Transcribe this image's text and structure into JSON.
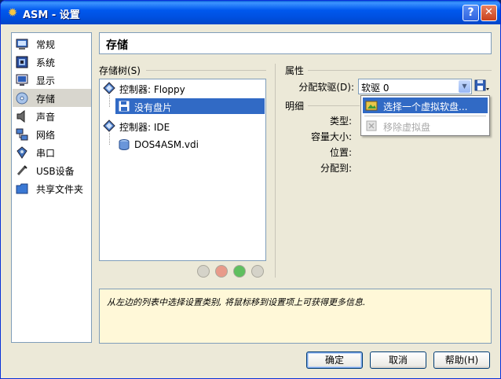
{
  "window": {
    "title": "ASM - 设置",
    "help_button": "?",
    "close_button": "✕"
  },
  "sidebar": {
    "items": [
      {
        "label": "常规",
        "icon": "general-icon"
      },
      {
        "label": "系统",
        "icon": "system-icon"
      },
      {
        "label": "显示",
        "icon": "display-icon"
      },
      {
        "label": "存储",
        "icon": "storage-icon",
        "selected": true
      },
      {
        "label": "声音",
        "icon": "audio-icon"
      },
      {
        "label": "网络",
        "icon": "network-icon"
      },
      {
        "label": "串口",
        "icon": "serial-port-icon"
      },
      {
        "label": "USB设备",
        "icon": "usb-icon"
      },
      {
        "label": "共享文件夹",
        "icon": "shared-folder-icon"
      }
    ]
  },
  "page": {
    "title": "存储"
  },
  "storage_tree": {
    "label": "存储树(S)",
    "items": [
      {
        "label": "控制器: Floppy",
        "icon": "floppy-controller-icon",
        "level": 0
      },
      {
        "label": "没有盘片",
        "icon": "floppy-disk-icon",
        "level": 1,
        "selected": true
      },
      {
        "label": "控制器: IDE",
        "icon": "ide-controller-icon",
        "level": 0
      },
      {
        "label": "DOS4ASM.vdi",
        "icon": "hard-disk-icon",
        "level": 1
      }
    ],
    "toolbar": [
      "add-controller-icon",
      "remove-controller-icon",
      "add-attachment-icon",
      "remove-attachment-icon"
    ]
  },
  "attributes": {
    "label": "属性",
    "floppy_label": "分配软驱(D):",
    "floppy_value": "软驱 0",
    "menu": [
      {
        "label": "选择一个虚拟软盘...",
        "icon": "choose-floppy-icon",
        "highlighted": true
      },
      {
        "label": "移除虚拟盘",
        "icon": "remove-floppy-icon",
        "disabled": true
      }
    ]
  },
  "details": {
    "label": "明细",
    "type_label": "类型:",
    "size_label": "容量大小:",
    "location_label": "位置:",
    "attached_label": "分配到:"
  },
  "info": {
    "text": "从左边的列表中选择设置类别, 将鼠标移到设置项上可获得更多信息."
  },
  "buttons": {
    "ok": "确定",
    "cancel": "取消",
    "help": "帮助(H)"
  },
  "colors": {
    "titlebar": "#0058ee",
    "selection": "#316ac5",
    "info_background": "#fff8d8",
    "dialog": "#ece9d8"
  }
}
